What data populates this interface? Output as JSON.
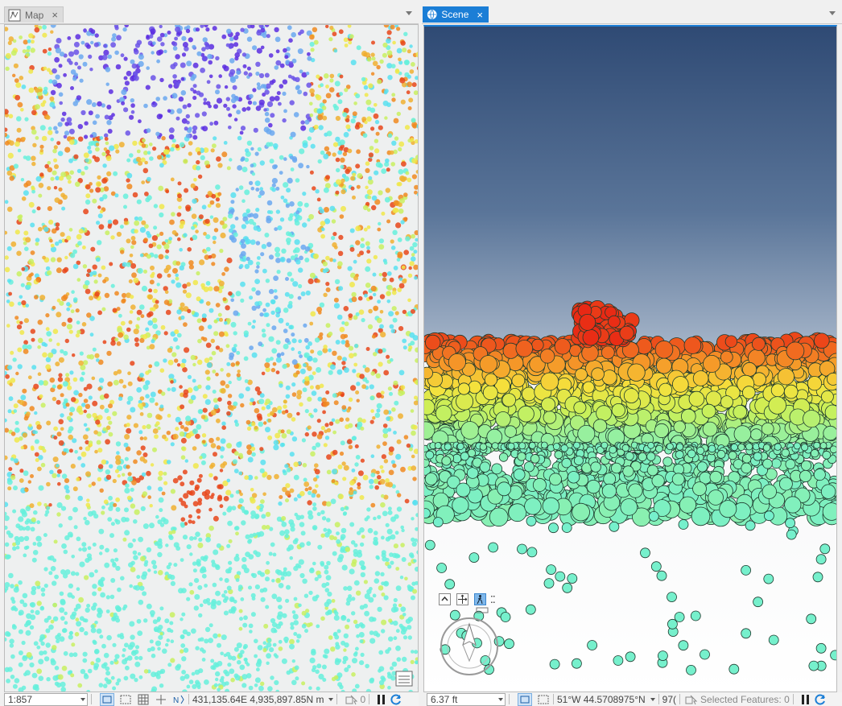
{
  "map_tab": {
    "label": "Map",
    "close_glyph": "×",
    "icon": "map-icon"
  },
  "scene_tab": {
    "label": "Scene",
    "close_glyph": "×",
    "icon": "scene-globe-icon"
  },
  "map_status": {
    "scale": "1:857",
    "coordinates": "431,135.64E 4,935,897.85N m",
    "selected_count": "0"
  },
  "scene_status": {
    "camera_height": "6.37 ft",
    "coordinates": "51°W 44.5708975°N",
    "extra": "97(",
    "selected_features": "Selected Features: 0"
  },
  "colors": {
    "accent": "#1b7ed6",
    "low": "#66f0dc",
    "mid": "#f0e84a",
    "high": "#e8461a",
    "top": "#e81a10",
    "sky_top": "#2f4a74",
    "sky_bottom": "#a8b8cc"
  }
}
